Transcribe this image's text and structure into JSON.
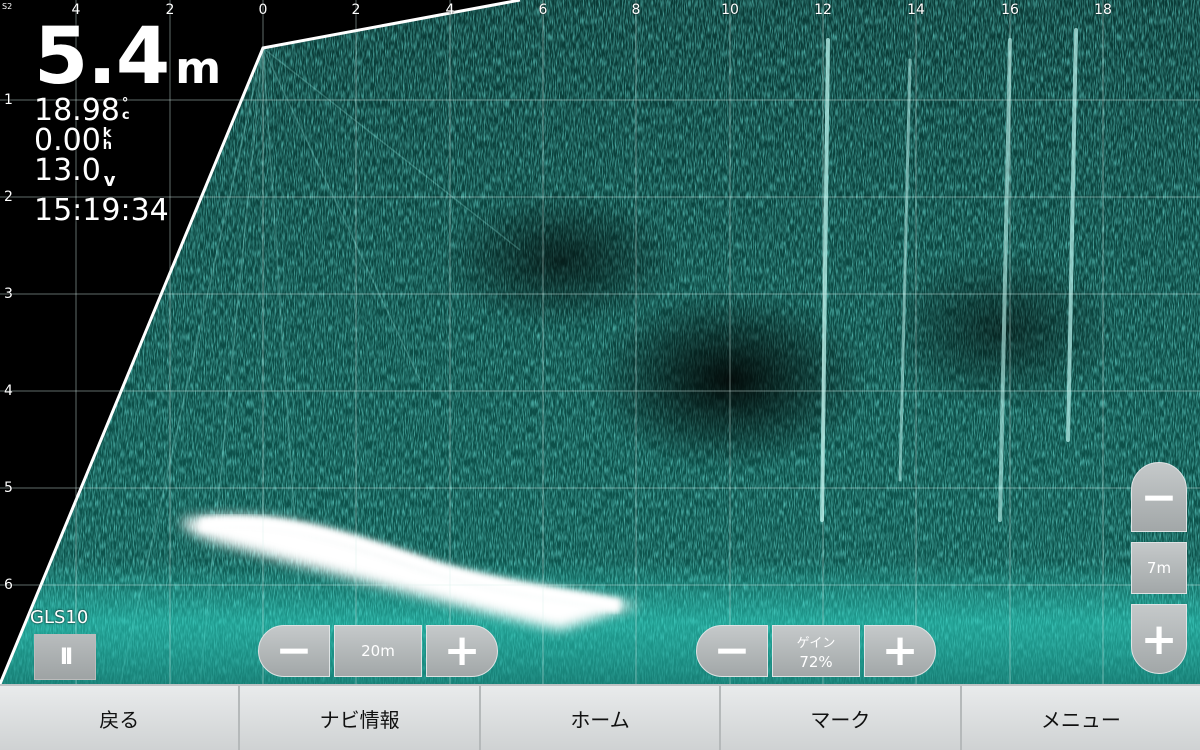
{
  "screen_label": "S2",
  "x_ticks": [
    "4",
    "2",
    "0",
    "2",
    "4",
    "6",
    "8",
    "10",
    "12",
    "14",
    "16",
    "18"
  ],
  "y_ticks": [
    "1",
    "2",
    "3",
    "4",
    "5",
    "6"
  ],
  "readout": {
    "depth": "5.4",
    "depth_unit": "m",
    "temperature": "18.98",
    "temperature_unit_top": "°",
    "temperature_unit_bottom": "c",
    "speed": "0.00",
    "speed_unit_top": "k",
    "speed_unit_bottom": "h",
    "voltage": "13.0",
    "voltage_unit": "v",
    "time": "15:19:34"
  },
  "transducer": {
    "label": "GLS10",
    "pause_icon": "pause-icon",
    "pause_glyph": "II"
  },
  "range_control": {
    "minus": "−",
    "value": "20m",
    "plus": "+"
  },
  "gain_control": {
    "minus": "−",
    "label": "ゲイン",
    "value": "72%",
    "plus": "+"
  },
  "zoom_control": {
    "minus": "−",
    "value": "7m",
    "plus": "+"
  },
  "softkeys": [
    "戻る",
    "ナビ情報",
    "ホーム",
    "マーク",
    "メニュー"
  ],
  "colors": {
    "sonar_accent": "#2fd6c6",
    "sonar_bright": "#ffffff",
    "background": "#000000",
    "button_gray": "#a9aeaf"
  }
}
